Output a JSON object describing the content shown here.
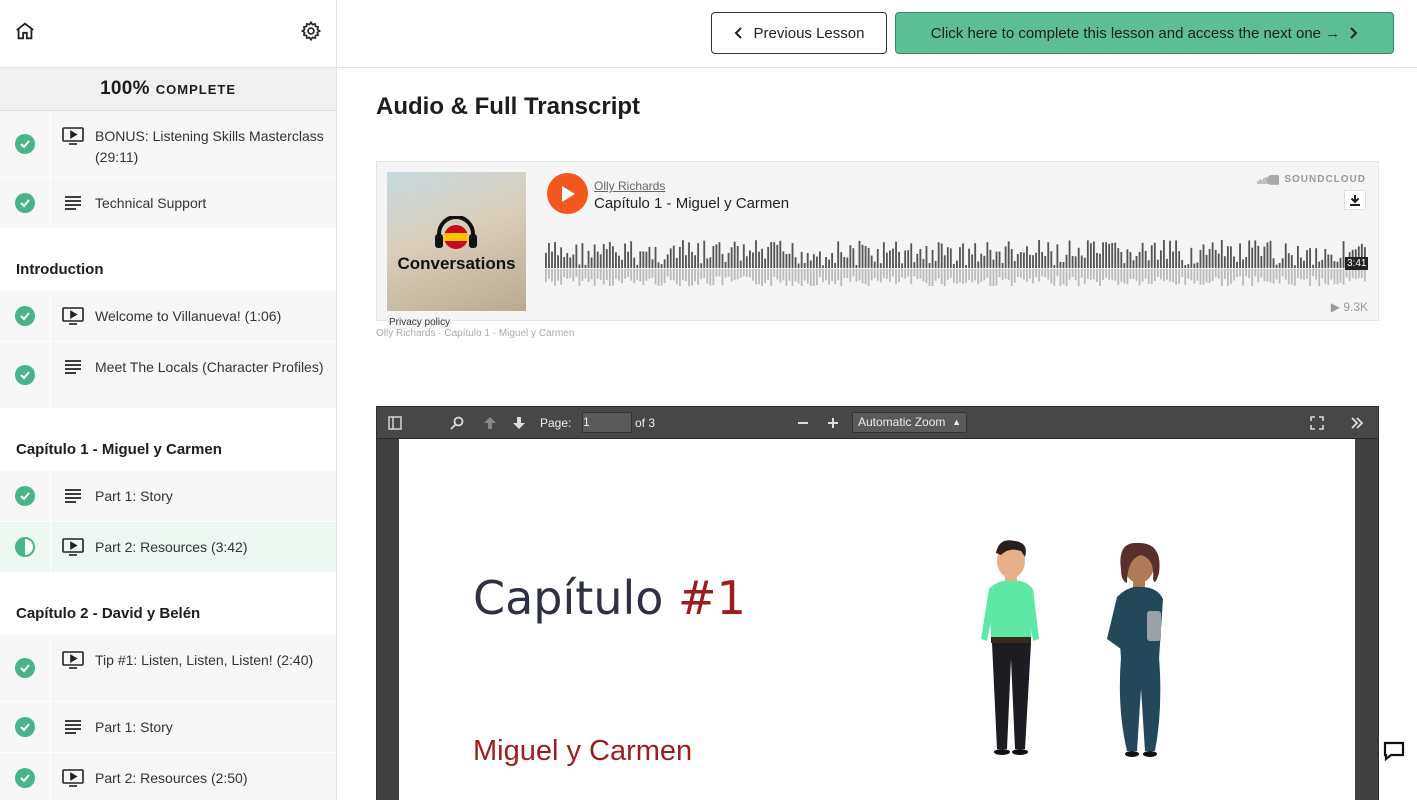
{
  "sidebar": {
    "progress_pct": "100%",
    "progress_label": "COMPLETE",
    "top_items": [
      {
        "label": "BONUS: Listening Skills Masterclass (29:11)",
        "type": "video"
      },
      {
        "label": "Technical Support",
        "type": "text"
      }
    ],
    "sections": [
      {
        "title": "Introduction",
        "items": [
          {
            "label": "Welcome to Villanueva! (1:06)",
            "type": "video"
          },
          {
            "label": "Meet The Locals (Character Profiles)",
            "type": "text"
          }
        ]
      },
      {
        "title": "Capítulo 1 - Miguel y Carmen",
        "items": [
          {
            "label": "Part 1: Story",
            "type": "text"
          },
          {
            "label": "Part 2: Resources (3:42)",
            "type": "video",
            "active": true
          }
        ]
      },
      {
        "title": "Capítulo 2 - David y Belén",
        "items": [
          {
            "label": "Tip #1: Listen, Listen, Listen! (2:40)",
            "type": "video"
          },
          {
            "label": "Part 1: Story",
            "type": "text"
          },
          {
            "label": "Part 2: Resources (2:50)",
            "type": "video"
          }
        ]
      }
    ]
  },
  "header": {
    "prev_label": "Previous Lesson",
    "next_label": "Click here to complete this lesson and access the next one →"
  },
  "main": {
    "title": "Audio & Full Transcript"
  },
  "soundcloud": {
    "artwork_title": "Conversations",
    "privacy": "Privacy policy",
    "user": "Olly Richards",
    "track": "Capítulo 1 - Miguel y Carmen",
    "brand": "SOUNDCLOUD",
    "duration": "3:41",
    "plays": "▶ 9.3K",
    "caption": "Olly Richards · Capítulo 1 - Miguel y Carmen"
  },
  "pdf": {
    "page_label": "Page:",
    "page_value": "1",
    "page_total": "of 3",
    "zoom": "Automatic Zoom",
    "title_text": "Capítulo",
    "title_num": "#1",
    "subtitle": "Miguel y Carmen"
  },
  "colors": {
    "accent_green": "#48b48a",
    "next_button": "#5dbd94",
    "soundcloud_orange": "#f2581e",
    "pdf_red": "#9c1d1d"
  }
}
